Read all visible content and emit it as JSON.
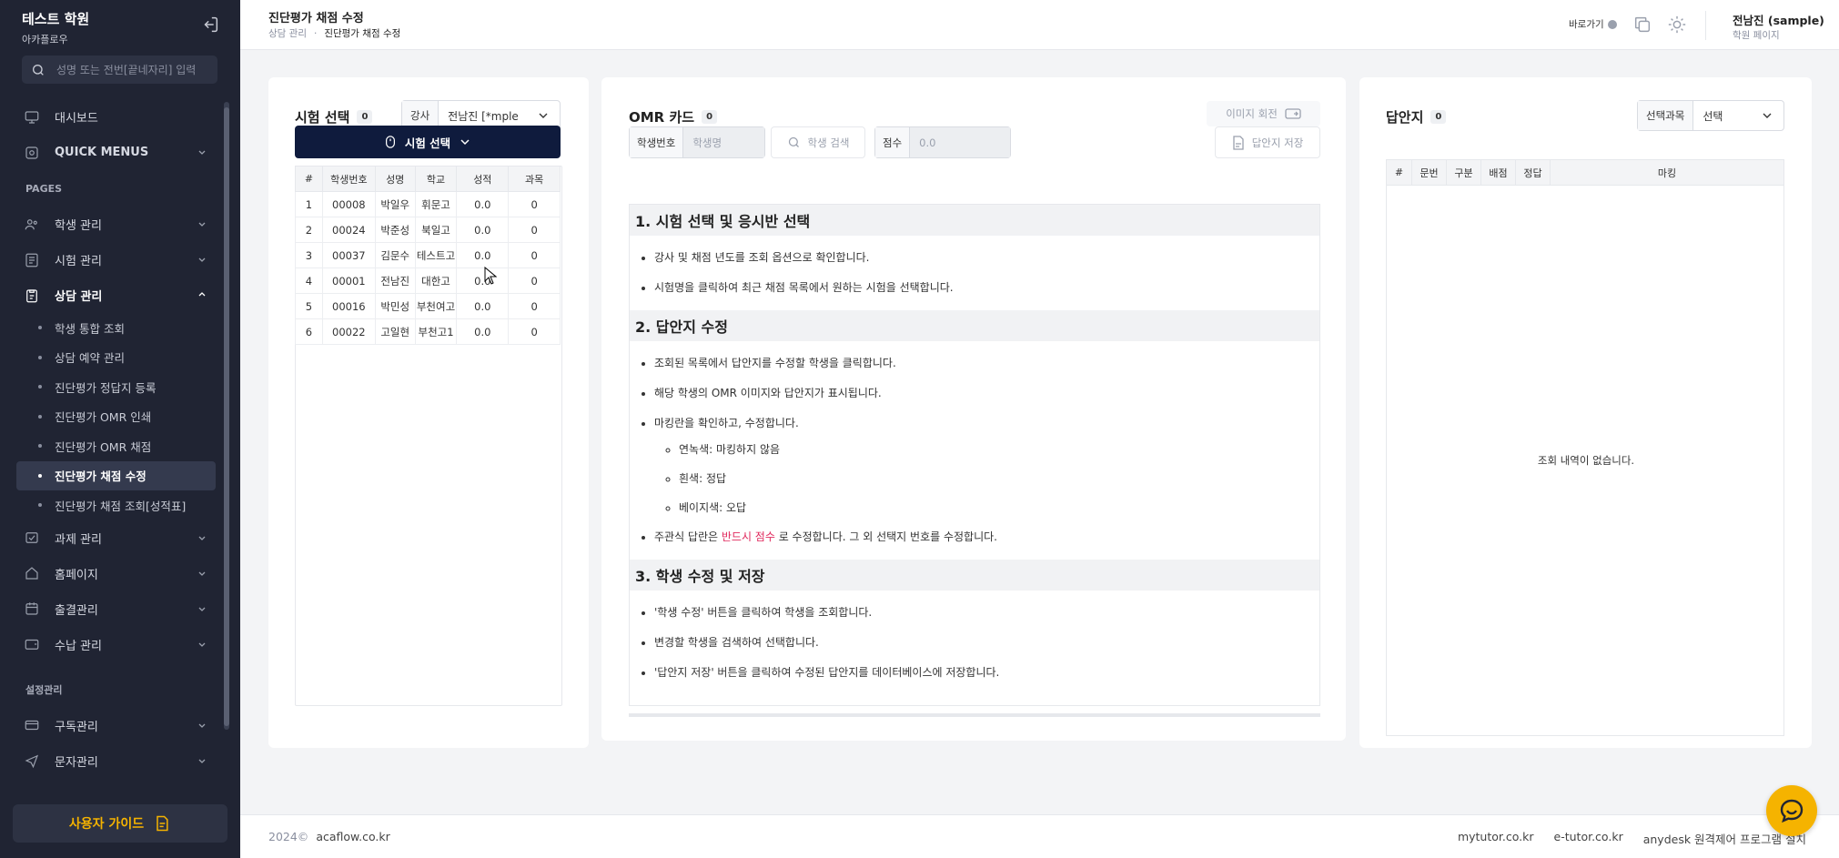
{
  "sidebar": {
    "brand_title": "테스트 학원",
    "brand_sub": "아카플로우",
    "search_placeholder": "성명 또는 전번[끝네자리] 입력",
    "items": [
      {
        "label": "대시보드",
        "icon": "monitor-icon"
      },
      {
        "label": "QUICK MENUS",
        "icon": "grid-icon"
      }
    ],
    "section_pages": "PAGES",
    "pages": [
      {
        "label": "학생 관리",
        "icon": "users-icon"
      },
      {
        "label": "시험 관리",
        "icon": "list-icon"
      },
      {
        "label": "상담 관리",
        "icon": "clipboard-icon"
      }
    ],
    "sub_items": [
      {
        "label": "학생 통합 조회"
      },
      {
        "label": "상담 예약 관리"
      },
      {
        "label": "진단평가 정답지 등록"
      },
      {
        "label": "진단평가 OMR 인쇄"
      },
      {
        "label": "진단평가 OMR 채점"
      },
      {
        "label": "진단평가 채점 수정"
      },
      {
        "label": "진단평가 채점 조회[성적표]"
      }
    ],
    "pages2": [
      {
        "label": "과제 관리",
        "icon": "task-icon"
      },
      {
        "label": "홈페이지",
        "icon": "home-icon"
      },
      {
        "label": "출결관리",
        "icon": "calendar-icon"
      },
      {
        "label": "수납 관리",
        "icon": "wallet-icon"
      }
    ],
    "section_settings": "설정관리",
    "settings": [
      {
        "label": "구독관리",
        "icon": "card-icon"
      },
      {
        "label": "문자관리",
        "icon": "send-icon"
      }
    ],
    "guide_button": "사용자 가이드"
  },
  "header": {
    "title": "진단평가 채점 수정",
    "breadcrumb_parent": "상담 관리",
    "breadcrumb_current": "진단평가 채점 수정",
    "shortcut": "바로가기",
    "user_name": "전남진 (sample)",
    "user_role": "학원 페이지"
  },
  "exam_panel": {
    "title": "시험 선택",
    "count": "0",
    "teacher_label": "강사",
    "teacher_value": "전남진 [*mple",
    "select_button": "시험 선택",
    "columns": [
      "#",
      "학생번호",
      "성명",
      "학교",
      "성적",
      "과목"
    ],
    "rows": [
      [
        "1",
        "00008",
        "박일우",
        "휘문고",
        "0.0",
        "0"
      ],
      [
        "2",
        "00024",
        "박준성",
        "북일고",
        "0.0",
        "0"
      ],
      [
        "3",
        "00037",
        "김문수",
        "테스트고",
        "0.0",
        "0"
      ],
      [
        "4",
        "00001",
        "전남진",
        "대한고",
        "0.0",
        "0"
      ],
      [
        "5",
        "00016",
        "박민성",
        "부천여고",
        "0.0",
        "0"
      ],
      [
        "6",
        "00022",
        "고일현",
        "부천고1",
        "0.0",
        "0"
      ]
    ]
  },
  "omr_panel": {
    "title": "OMR 카드",
    "count": "0",
    "rotate_label": "이미지 회전",
    "student_no_label": "학생번호",
    "student_name_placeholder": "학생명",
    "search_student": "학생 검색",
    "score_label": "점수",
    "score_value": "0.0",
    "save_button": "답안지 저장",
    "guide": {
      "s1_title": "1. 시험 선택 및 응시반 선택",
      "s1_items": [
        "강사 및 채점 년도를 조회 옵션으로 확인합니다.",
        "시험명을 클릭하여 최근 채점 목록에서 원하는 시험을 선택합니다."
      ],
      "s2_title": "2. 답안지 수정",
      "s2_items": [
        "조회된 목록에서 답안지를 수정할 학생을 클릭합니다.",
        "해당 학생의 OMR 이미지와 답안지가 표시됩니다.",
        "마킹란을 확인하고, 수정합니다."
      ],
      "s2_sub": [
        "연녹색: 마킹하지 않음",
        "흰색: 정답",
        "베이지색: 오답"
      ],
      "s2_last_pre": "주관식 답란은 ",
      "s2_last_red": "반드시 점수",
      "s2_last_post": " 로 수정합니다. 그 외 선택지 번호를 수정합니다.",
      "s3_title": "3. 학생 수정 및 저장",
      "s3_items": [
        "'학생 수정' 버튼을 클릭하여 학생을 조회합니다.",
        "변경할 학생을 검색하여 선택합니다.",
        "'답안지 저장' 버튼을 클릭하여 수정된 답안지를 데이터베이스에 저장합니다."
      ]
    }
  },
  "answer_panel": {
    "title": "답안지",
    "count": "0",
    "subject_label": "선택과목",
    "subject_value": "선택",
    "columns": [
      "#",
      "문번",
      "구분",
      "배점",
      "정답",
      "마킹"
    ],
    "empty": "조회 내역이 없습니다."
  },
  "footer": {
    "year": "2024©",
    "site": "acaflow.co.kr",
    "links": [
      "mytutor.co.kr",
      "e-tutor.co.kr",
      "anydesk 원격제어 프로그램 설치"
    ]
  },
  "colors": {
    "sidebar_bg": "#202433",
    "primary": "#0f1b3d",
    "accent": "#f5b300",
    "red": "#e0285c"
  }
}
